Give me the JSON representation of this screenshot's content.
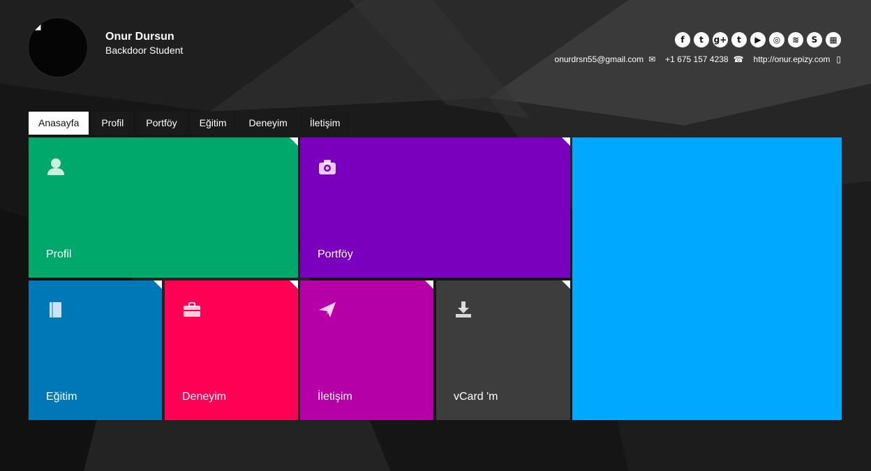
{
  "profile": {
    "name": "Onur Dursun",
    "title": "Backdoor Student"
  },
  "socials": [
    {
      "icon": "facebook-icon",
      "glyph": "f"
    },
    {
      "icon": "twitter-icon",
      "glyph": "t"
    },
    {
      "icon": "google-plus-icon",
      "glyph": "g+"
    },
    {
      "icon": "tumblr-icon",
      "glyph": "t"
    },
    {
      "icon": "youtube-icon",
      "glyph": "▶"
    },
    {
      "icon": "instagram-icon",
      "glyph": "◎"
    },
    {
      "icon": "slideshare-icon",
      "glyph": "≋"
    },
    {
      "icon": "skype-icon",
      "glyph": "S"
    },
    {
      "icon": "qr-code-icon",
      "glyph": "▦"
    }
  ],
  "contact": {
    "email": "onurdrsn55@gmail.com",
    "phone": "+1 675 157 4238",
    "website": "http://onur.epizy.com"
  },
  "nav": {
    "tabs": [
      "Anasayfa",
      "Profil",
      "Portföy",
      "Eğitim",
      "Deneyim",
      "İletişim"
    ],
    "active": "Anasayfa"
  },
  "tiles": {
    "profil": {
      "label": "Profil",
      "color": "#00a86b",
      "icon": "user-icon"
    },
    "portfoy": {
      "label": "Portföy",
      "color": "#7a00bd",
      "icon": "camera-icon"
    },
    "egitim": {
      "label": "Eğitim",
      "color": "#0078b8",
      "icon": "book-icon"
    },
    "deneyim": {
      "label": "Deneyim",
      "color": "#ff0055",
      "icon": "briefcase-icon"
    },
    "iletisim": {
      "label": "İletişim",
      "color": "#b400a6",
      "icon": "paper-plane-icon"
    },
    "vcard": {
      "label": "vCard 'm",
      "color": "#3d3d3d",
      "icon": "download-icon"
    },
    "feature": {
      "color": "#00a8ff"
    }
  }
}
